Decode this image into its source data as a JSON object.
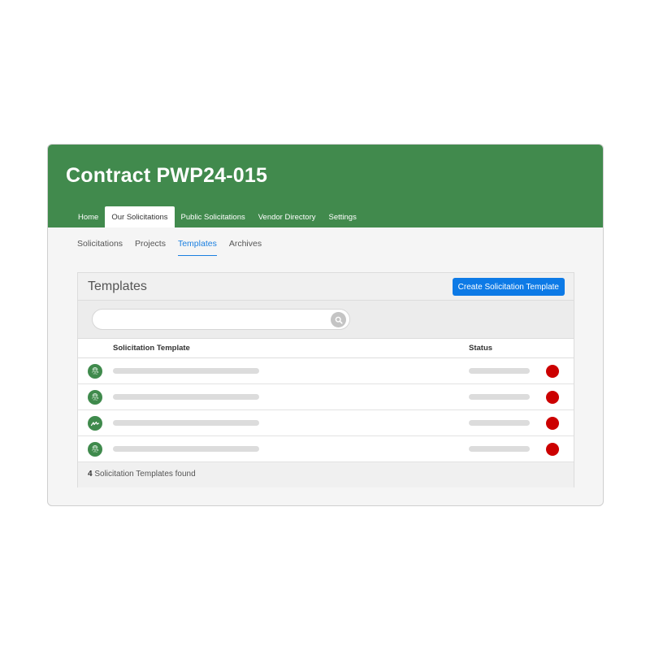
{
  "header": {
    "title": "Contract PWP24-015"
  },
  "topnav": [
    {
      "label": "Home",
      "active": false
    },
    {
      "label": "Our Solicitations",
      "active": true
    },
    {
      "label": "Public Solicitations",
      "active": false
    },
    {
      "label": "Vendor Directory",
      "active": false
    },
    {
      "label": "Settings",
      "active": false
    }
  ],
  "subnav": [
    {
      "label": "Solicitations",
      "active": false
    },
    {
      "label": "Projects",
      "active": false
    },
    {
      "label": "Templates",
      "active": true
    },
    {
      "label": "Archives",
      "active": false
    }
  ],
  "panel": {
    "title": "Templates",
    "create_button": "Create Solicitation Template",
    "search": {
      "value": "",
      "placeholder": ""
    },
    "columns": {
      "name": "Solicitation Template",
      "status": "Status"
    },
    "rows": [
      {
        "icon": "fingerprint-icon",
        "status_color": "#cc0000"
      },
      {
        "icon": "fingerprint-icon",
        "status_color": "#cc0000"
      },
      {
        "icon": "signature-icon",
        "status_color": "#cc0000"
      },
      {
        "icon": "fingerprint-icon",
        "status_color": "#cc0000"
      }
    ],
    "footer": {
      "count": "4",
      "text": "Solicitation Templates found"
    }
  },
  "colors": {
    "header": "#418a4d",
    "accent": "#0d7ae6",
    "status_dot": "#cc0000"
  }
}
